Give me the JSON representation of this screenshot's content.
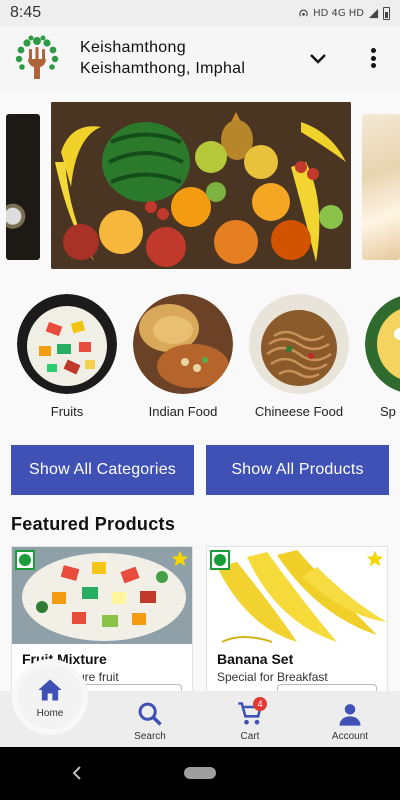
{
  "status_bar": {
    "time": "8:45",
    "network": "HD 4G HD"
  },
  "header": {
    "title": "Keishamthong",
    "subtitle": "Keishamthong, Imphal",
    "logo_icon": "fork-tree-logo-icon",
    "dropdown_icon": "chevron-down-icon",
    "menu_icon": "more-vert-icon"
  },
  "categories": [
    {
      "label": "Fruits",
      "icon": "fruit-salad-image"
    },
    {
      "label": "Indian Food",
      "icon": "puri-image"
    },
    {
      "label": "Chineese Food",
      "icon": "noodles-image"
    },
    {
      "label": "Sp",
      "icon": "dish-image"
    }
  ],
  "buttons": {
    "show_categories": "Show All Categories",
    "show_products": "Show All Products"
  },
  "featured": {
    "title": "Featured Products",
    "products": [
      {
        "name": "Fruit Mixture",
        "description": "Fresh mixture fruit"
      },
      {
        "name": "Banana Set",
        "description": "Special for Breakfast"
      }
    ]
  },
  "bottom_nav": {
    "home": "Home",
    "search": "Search",
    "cart": "Cart",
    "cart_count": "4",
    "account": "Account"
  },
  "colors": {
    "primary": "#3f51b5",
    "veg": "#1a9c3a",
    "star": "#f5d600",
    "badge": "#e53935"
  }
}
